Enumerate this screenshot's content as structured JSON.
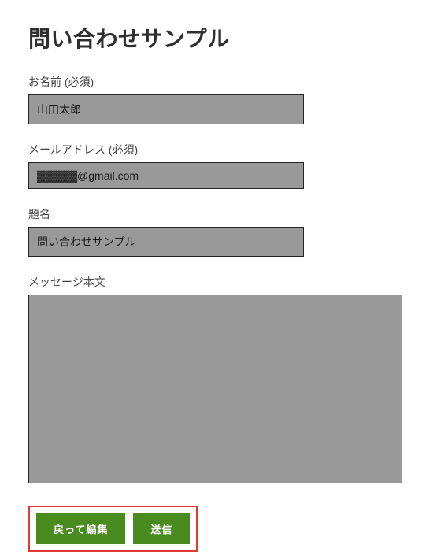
{
  "page": {
    "title": "問い合わせサンプル"
  },
  "form": {
    "name": {
      "label": "お名前 (必須)",
      "value": "山田太郎"
    },
    "email": {
      "label": "メールアドレス (必須)",
      "value": "▓▓▓▓▓@gmail.com"
    },
    "subject": {
      "label": "題名",
      "value": "問い合わせサンプル"
    },
    "message": {
      "label": "メッセージ本文",
      "value": ""
    }
  },
  "buttons": {
    "back_edit": "戻って編集",
    "submit": "送信"
  }
}
